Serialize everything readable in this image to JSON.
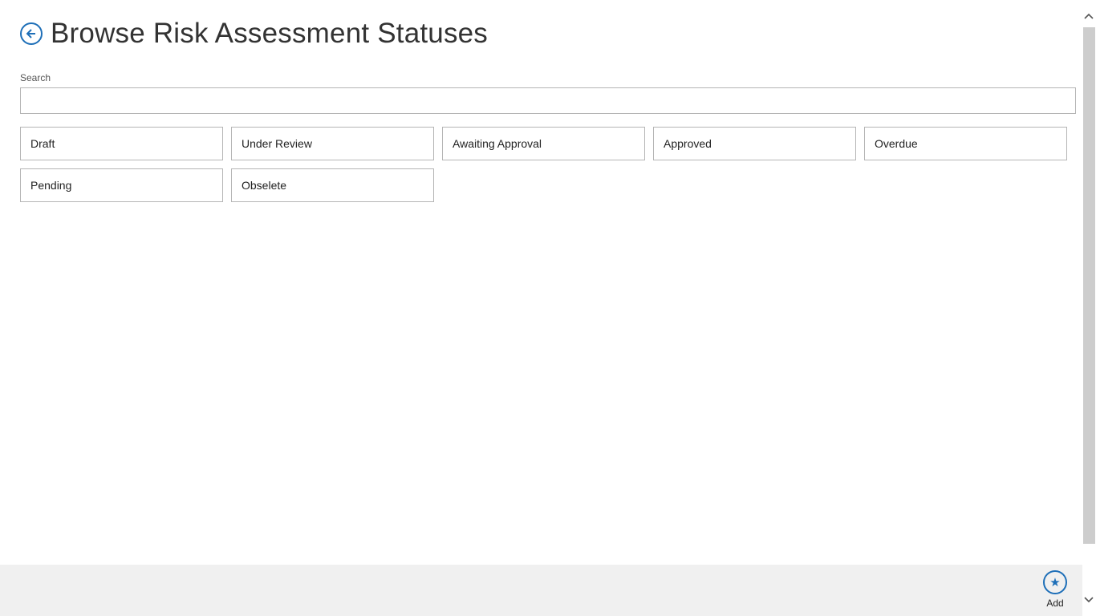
{
  "header": {
    "title": "Browse Risk Assessment Statuses"
  },
  "search": {
    "label": "Search",
    "value": "",
    "placeholder": ""
  },
  "statuses": [
    "Draft",
    "Under Review",
    "Awaiting Approval",
    "Approved",
    "Overdue",
    "Pending",
    "Obselete"
  ],
  "app_bar": {
    "add_label": "Add",
    "add_icon": "star-icon"
  },
  "icons": {
    "back": "back-arrow-icon",
    "scroll_up": "chevron-up-icon",
    "scroll_down": "chevron-down-icon"
  },
  "colors": {
    "accent": "#1e6fb8",
    "app_bar_background": "#f0f0f0",
    "tile_border": "#b5b5b5"
  }
}
